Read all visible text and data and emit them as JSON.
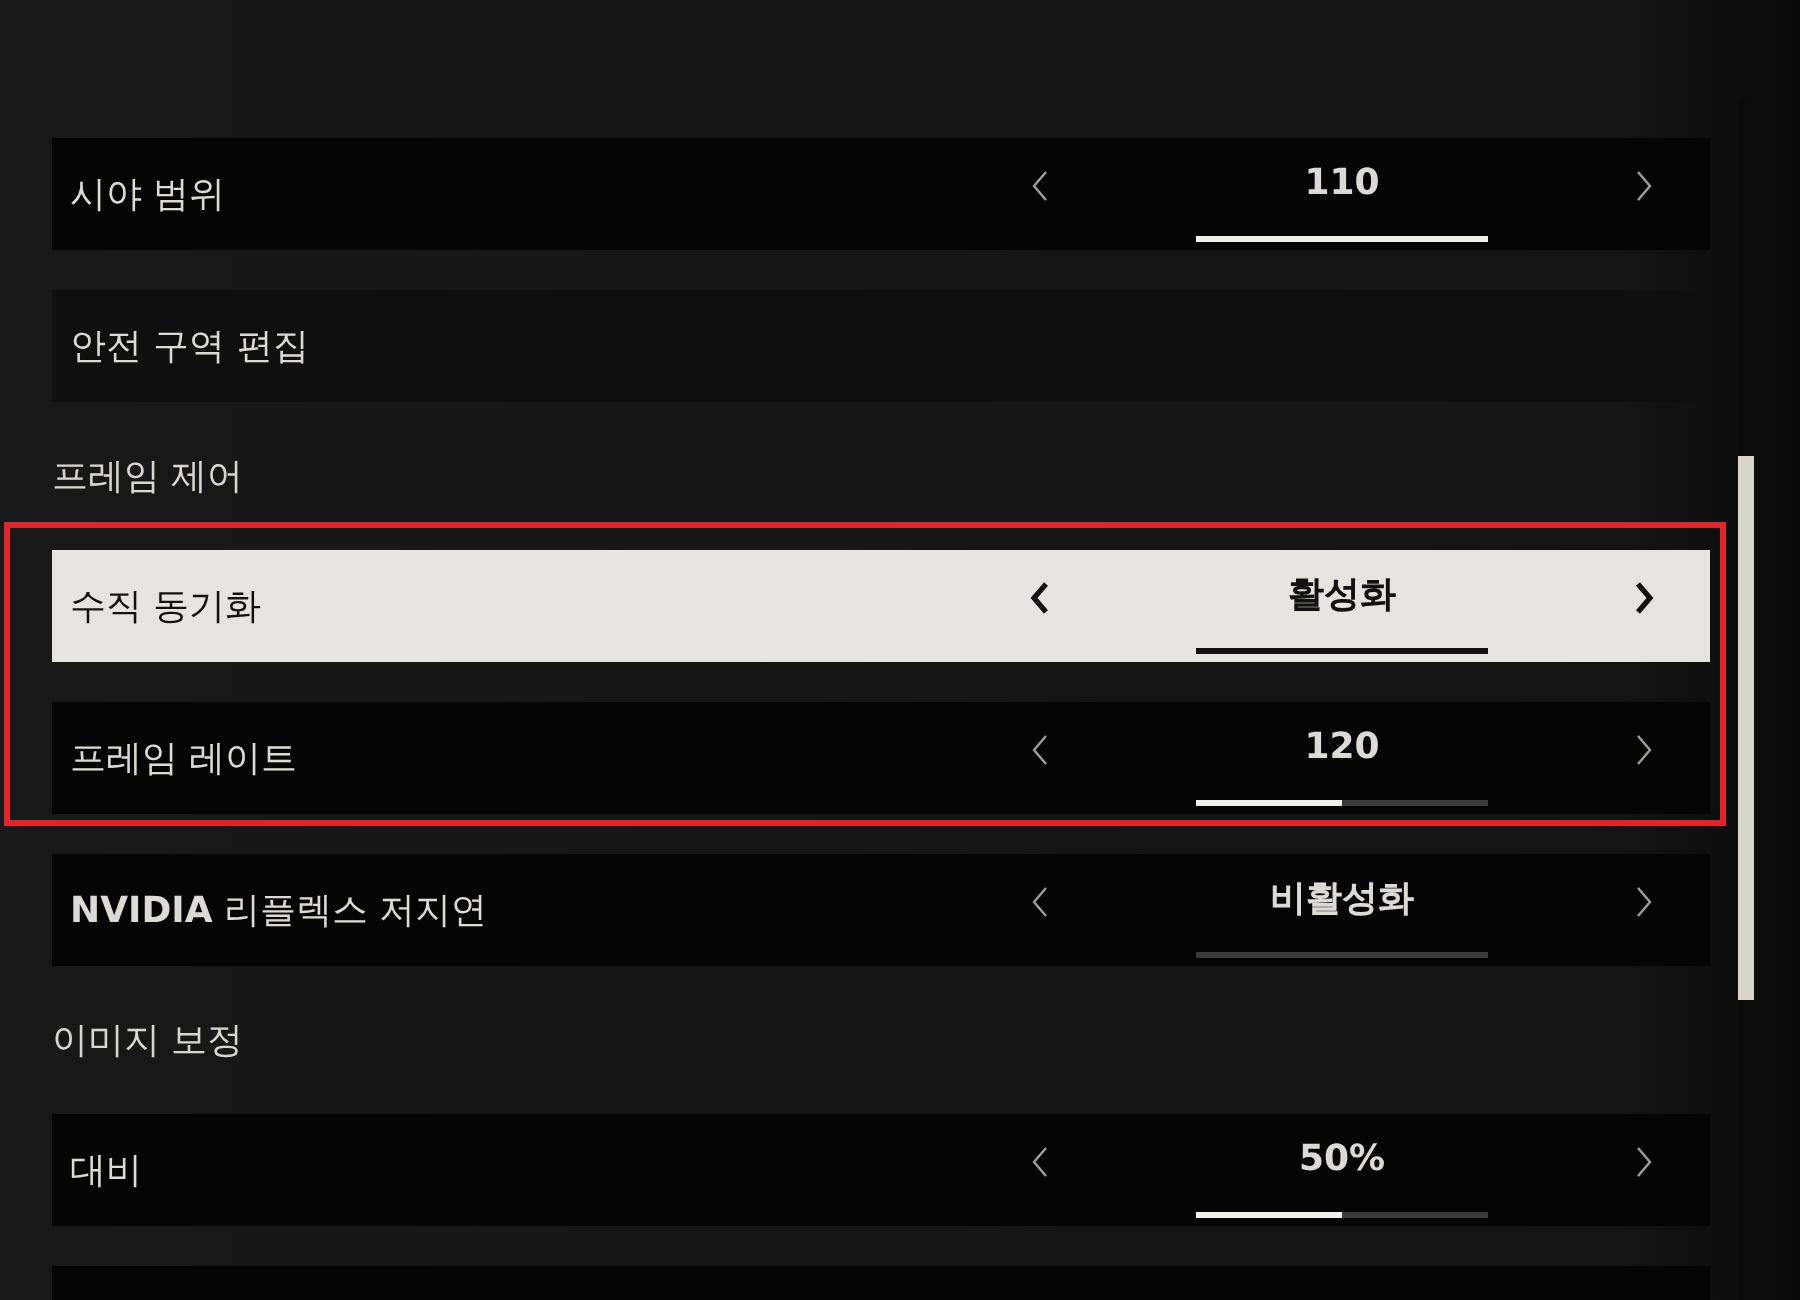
{
  "items": [
    {
      "kind": "selector",
      "label": "시야 범위",
      "value": "110",
      "level": 1,
      "selected": false
    },
    {
      "kind": "action",
      "label": "안전 구역 편집",
      "selected": false
    },
    {
      "kind": "heading",
      "label": "프레임 제어"
    },
    {
      "kind": "selector",
      "label": "수직 동기화",
      "value": "활성화",
      "level": 1,
      "selected": true
    },
    {
      "kind": "selector",
      "label": "프레임 레이트",
      "value": "120",
      "level": 0.5,
      "selected": false
    },
    {
      "kind": "selector",
      "label": "**NVIDIA** 리플렉스 저지연",
      "value": "비활성화",
      "level": 0,
      "selected": false
    },
    {
      "kind": "heading",
      "label": "이미지 보정"
    },
    {
      "kind": "selector",
      "label": "대비",
      "value": "50%",
      "level": 0.5,
      "selected": false
    },
    {
      "kind": "blank",
      "selected": false
    }
  ]
}
